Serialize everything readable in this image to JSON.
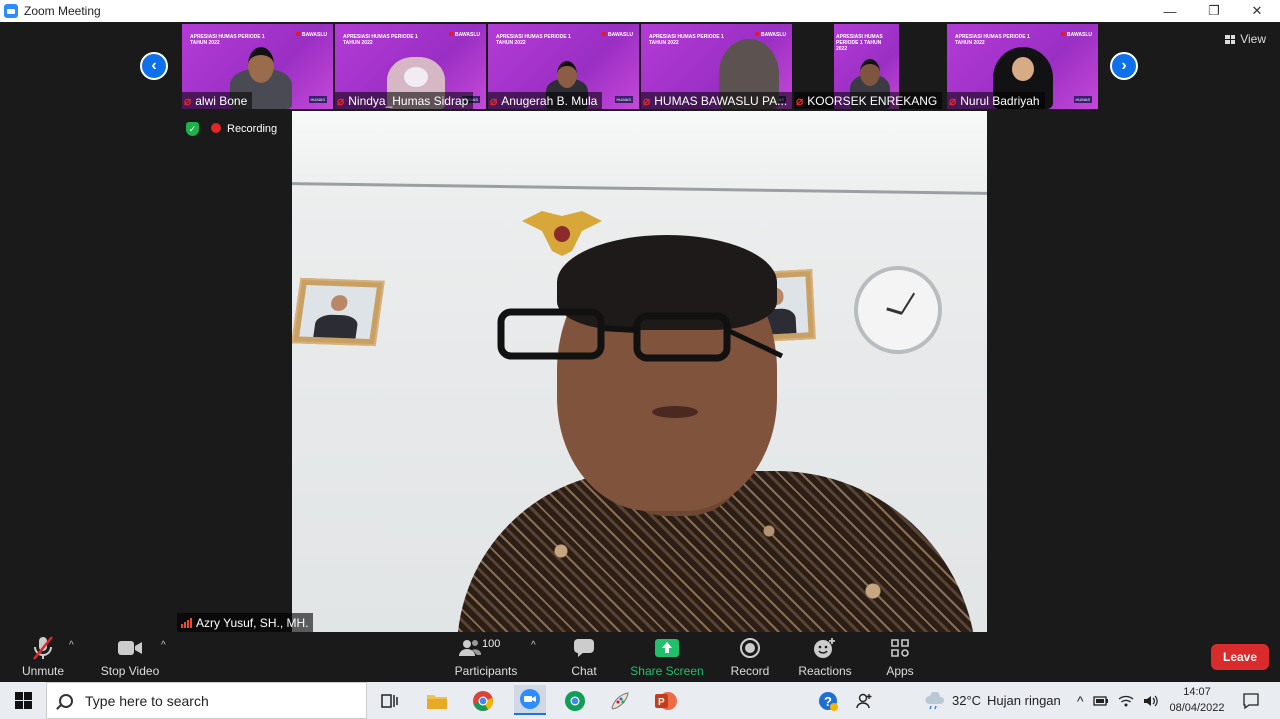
{
  "window": {
    "title": "Zoom Meeting",
    "minimize": "—",
    "restore": "❐",
    "close": "✕"
  },
  "gallery": {
    "view_label": "View",
    "slide_title": "APRESIASI HUMAS PERIODE 1 TAHUN 2022",
    "slide_brand": "BAWASLU",
    "slide_tag": "HUMAS",
    "participants": [
      {
        "name": "alwi Bone",
        "muted": true
      },
      {
        "name": "Nindya_Humas Sidrap",
        "muted": true
      },
      {
        "name": "Anugerah B. Mula",
        "muted": true
      },
      {
        "name": "HUMAS BAWASLU PA...",
        "muted": true
      },
      {
        "name": "KOORSEK ENREKANG",
        "muted": true
      },
      {
        "name": "Nurul Badriyah",
        "muted": true
      }
    ]
  },
  "status": {
    "recording_label": "Recording"
  },
  "active_speaker": {
    "name": "Azry Yusuf, SH., MH."
  },
  "toolbar": {
    "unmute": "Unmute",
    "stop_video": "Stop Video",
    "participants": "Participants",
    "participants_count": "100",
    "chat": "Chat",
    "share_screen": "Share Screen",
    "record": "Record",
    "reactions": "Reactions",
    "apps": "Apps",
    "leave": "Leave"
  },
  "taskbar": {
    "search_placeholder": "Type here to search",
    "weather_temp": "32°C",
    "weather_desc": "Hujan ringan",
    "time": "14:07",
    "date": "08/04/2022"
  },
  "colors": {
    "accent": "#0e71eb",
    "leave": "#d92b2b",
    "share": "#21c16b",
    "slide": "#b43bd6"
  }
}
